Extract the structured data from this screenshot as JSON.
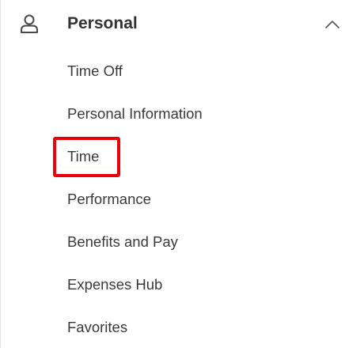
{
  "section": {
    "title": "Personal",
    "icon": "person-icon",
    "toggle_icon": "chevron-up-icon",
    "expanded": true
  },
  "menu": {
    "items": [
      {
        "label": "Time Off"
      },
      {
        "label": "Personal Information"
      },
      {
        "label": "Time",
        "highlighted": true
      },
      {
        "label": "Performance"
      },
      {
        "label": "Benefits and Pay"
      },
      {
        "label": "Expenses Hub"
      },
      {
        "label": "Favorites"
      }
    ]
  },
  "colors": {
    "highlight": "#e8000b",
    "text": "#3a3a3a",
    "heading": "#333333"
  }
}
